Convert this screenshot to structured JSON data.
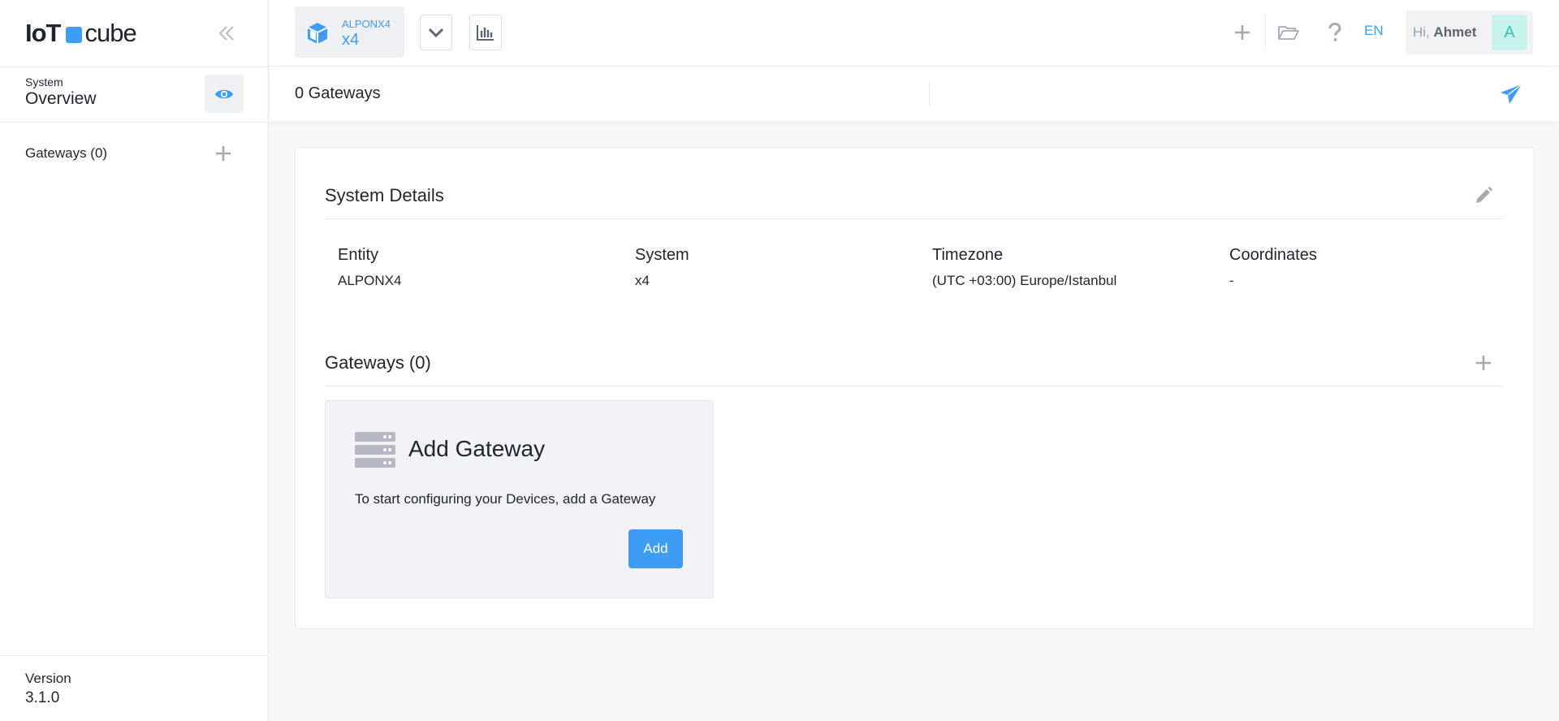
{
  "brand": {
    "part1": "IoT",
    "part2": "cube",
    "accent": "#3d9df5"
  },
  "sidebar": {
    "system_label": "System",
    "system_title": "Overview",
    "gateways_label": "Gateways (0)",
    "version_label": "Version",
    "version_value": "3.1.0"
  },
  "topbar": {
    "system_sub": "ALPONX4",
    "system_main": "x4",
    "language": "EN",
    "greeting": "Hi,",
    "user_name": "Ahmet",
    "avatar_initial": "A"
  },
  "subheader": {
    "title": "0 Gateways"
  },
  "system_details": {
    "title": "System Details",
    "columns": [
      {
        "label": "Entity",
        "value": "ALPONX4"
      },
      {
        "label": "System",
        "value": "x4"
      },
      {
        "label": "Timezone",
        "value": "(UTC +03:00) Europe/Istanbul"
      },
      {
        "label": "Coordinates",
        "value": "-"
      }
    ]
  },
  "gateways_section": {
    "title": "Gateways (0)",
    "add_card": {
      "title": "Add Gateway",
      "description": "To start configuring your Devices, add a Gateway",
      "button_label": "Add"
    }
  },
  "icons": [
    "double-chevron-left-icon",
    "eye-icon",
    "plus-icon",
    "cube-icon",
    "chevron-down-icon",
    "bar-chart-icon",
    "folder-open-icon",
    "question-icon",
    "send-icon",
    "pencil-icon",
    "server-icon"
  ]
}
